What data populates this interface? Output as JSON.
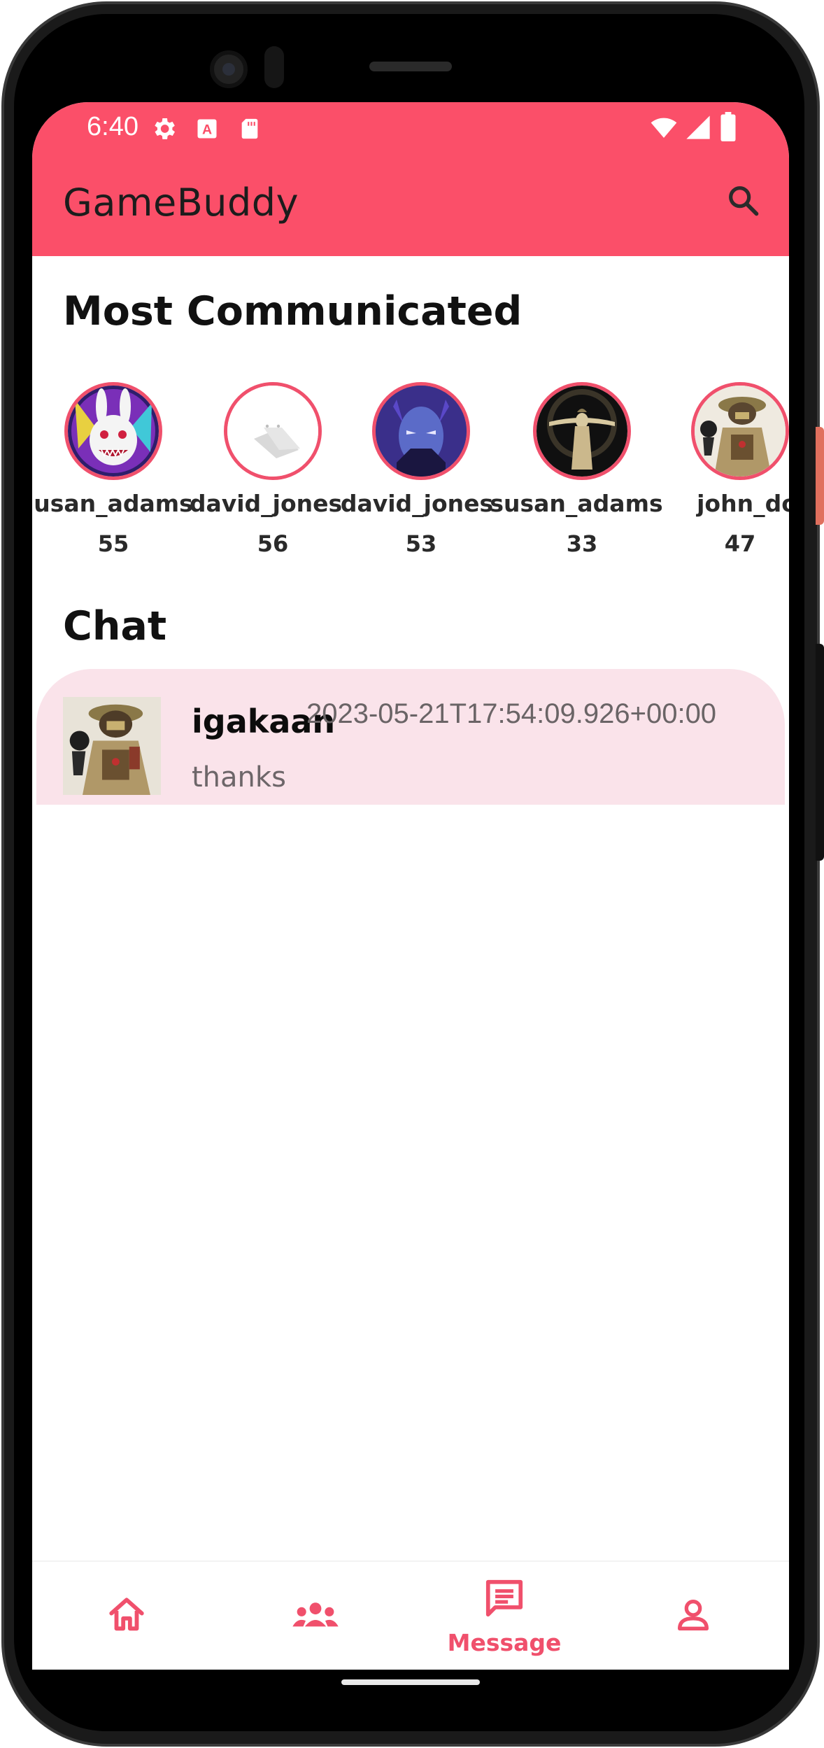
{
  "status_bar": {
    "time": "6:40",
    "left_icons": [
      "gear-icon",
      "font-a-icon",
      "sd-card-icon"
    ],
    "right_icons": [
      "wifi-icon",
      "cell-signal-icon",
      "battery-icon"
    ]
  },
  "app_bar": {
    "title": "GameBuddy",
    "action_icon": "search-icon"
  },
  "most_communicated": {
    "title": "Most Communicated",
    "users": [
      {
        "name": "usan_adams",
        "count": "55",
        "avatar": "rabbit-mask-avatar"
      },
      {
        "name": "david_jones",
        "count": "56",
        "avatar": "placeholder-avatar"
      },
      {
        "name": "david_jones",
        "count": "53",
        "avatar": "blue-demon-avatar"
      },
      {
        "name": "susan_adams",
        "count": "33",
        "avatar": "dark-figure-avatar"
      },
      {
        "name": "john_do",
        "count": "47",
        "avatar": "soldier-avatar"
      }
    ]
  },
  "chat": {
    "title": "Chat",
    "items": [
      {
        "name": "igakaan",
        "timestamp": "2023-05-21T17:54:09.926+00:00",
        "message": "thanks",
        "avatar": "soldier-avatar"
      }
    ]
  },
  "bottom_nav": {
    "items": [
      {
        "icon": "home-icon",
        "label": ""
      },
      {
        "icon": "group-icon",
        "label": ""
      },
      {
        "icon": "message-icon",
        "label": "Message"
      },
      {
        "icon": "profile-icon",
        "label": ""
      }
    ],
    "active_index": 2
  },
  "colors": {
    "primary": "#fb4f69",
    "accent": "#f0506c",
    "chat_bg": "#fae3ea"
  }
}
